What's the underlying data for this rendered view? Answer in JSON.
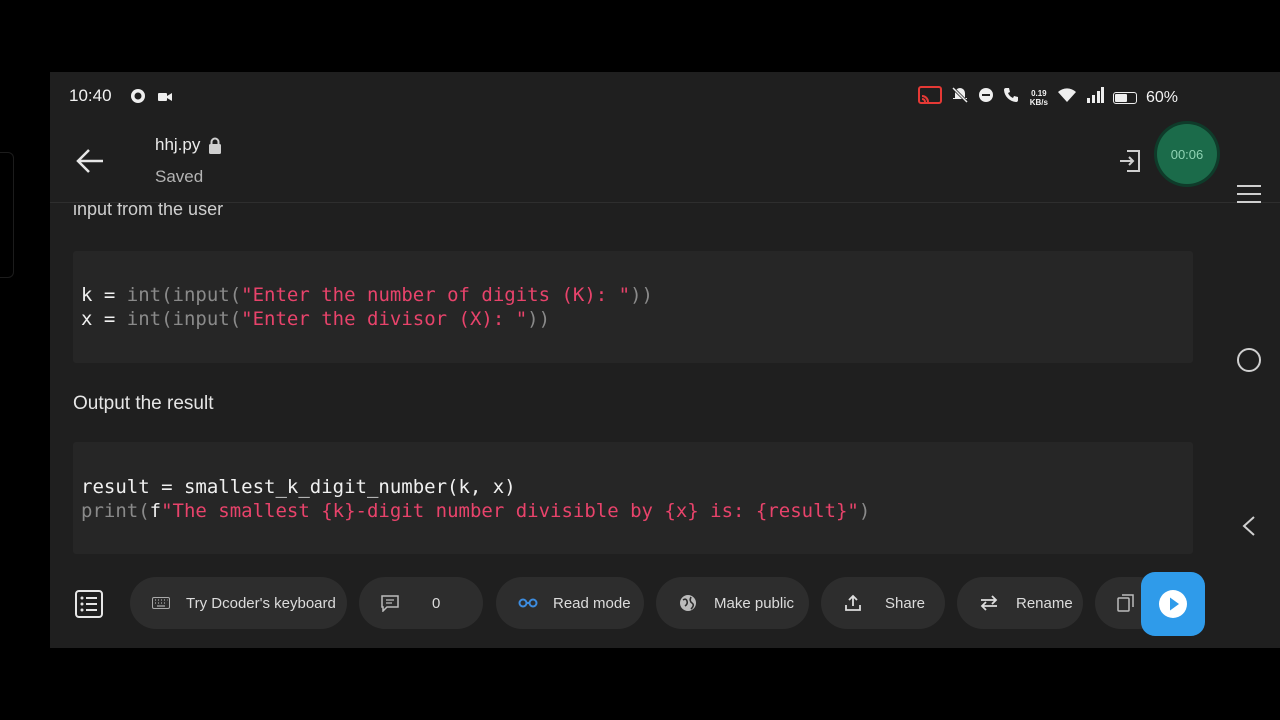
{
  "status_bar": {
    "time": "10:40",
    "net_speed_value": "0.19",
    "net_speed_unit": "KB/s",
    "battery_percent": "60%",
    "battery_level": 0.6
  },
  "app_bar": {
    "file_name": "hhj.py",
    "save_status": "Saved",
    "recording_timer": "00:06"
  },
  "content": {
    "clipped_text": "input from the user",
    "code_block_1": [
      {
        "var": "k",
        "op": " = ",
        "fn": "int(input(",
        "str": "\"Enter the number of digits (K): \"",
        "close": "))"
      },
      {
        "var": "x",
        "op": " = ",
        "fn": "int(input(",
        "str": "\"Enter the divisor (X): \"",
        "close": "))"
      }
    ],
    "section_heading": "Output the result",
    "code_block_2": {
      "line1": "result = smallest_k_digit_number(k, x)",
      "line2_fn": "print(",
      "line2_f": "f",
      "line2_str": "\"The smallest {k}-digit number divisible by {x} is: {result}\"",
      "line2_close": ")"
    }
  },
  "toolbar": {
    "keyboard_label": "Try Dcoder's keyboard",
    "comments_count": "0",
    "read_mode_label": "Read mode",
    "make_public_label": "Make public",
    "share_label": "Share",
    "rename_label": "Rename"
  },
  "colors": {
    "background": "#1f1f1f",
    "code_bg": "#262626",
    "string": "#e8436b",
    "keyword": "#8a8a8a",
    "accent_run": "#2f9bea",
    "read_mode_icon": "#3d8de0",
    "recording": "#1b6b4a"
  },
  "icons": {
    "back": "arrow-left-icon",
    "lock": "lock-icon",
    "exit": "exit-icon",
    "list": "list-icon",
    "keyboard": "keyboard-icon",
    "comment": "comment-icon",
    "read_mode": "glasses-icon",
    "globe": "globe-icon",
    "share": "upload-icon",
    "rename": "swap-icon",
    "run": "play-icon"
  }
}
